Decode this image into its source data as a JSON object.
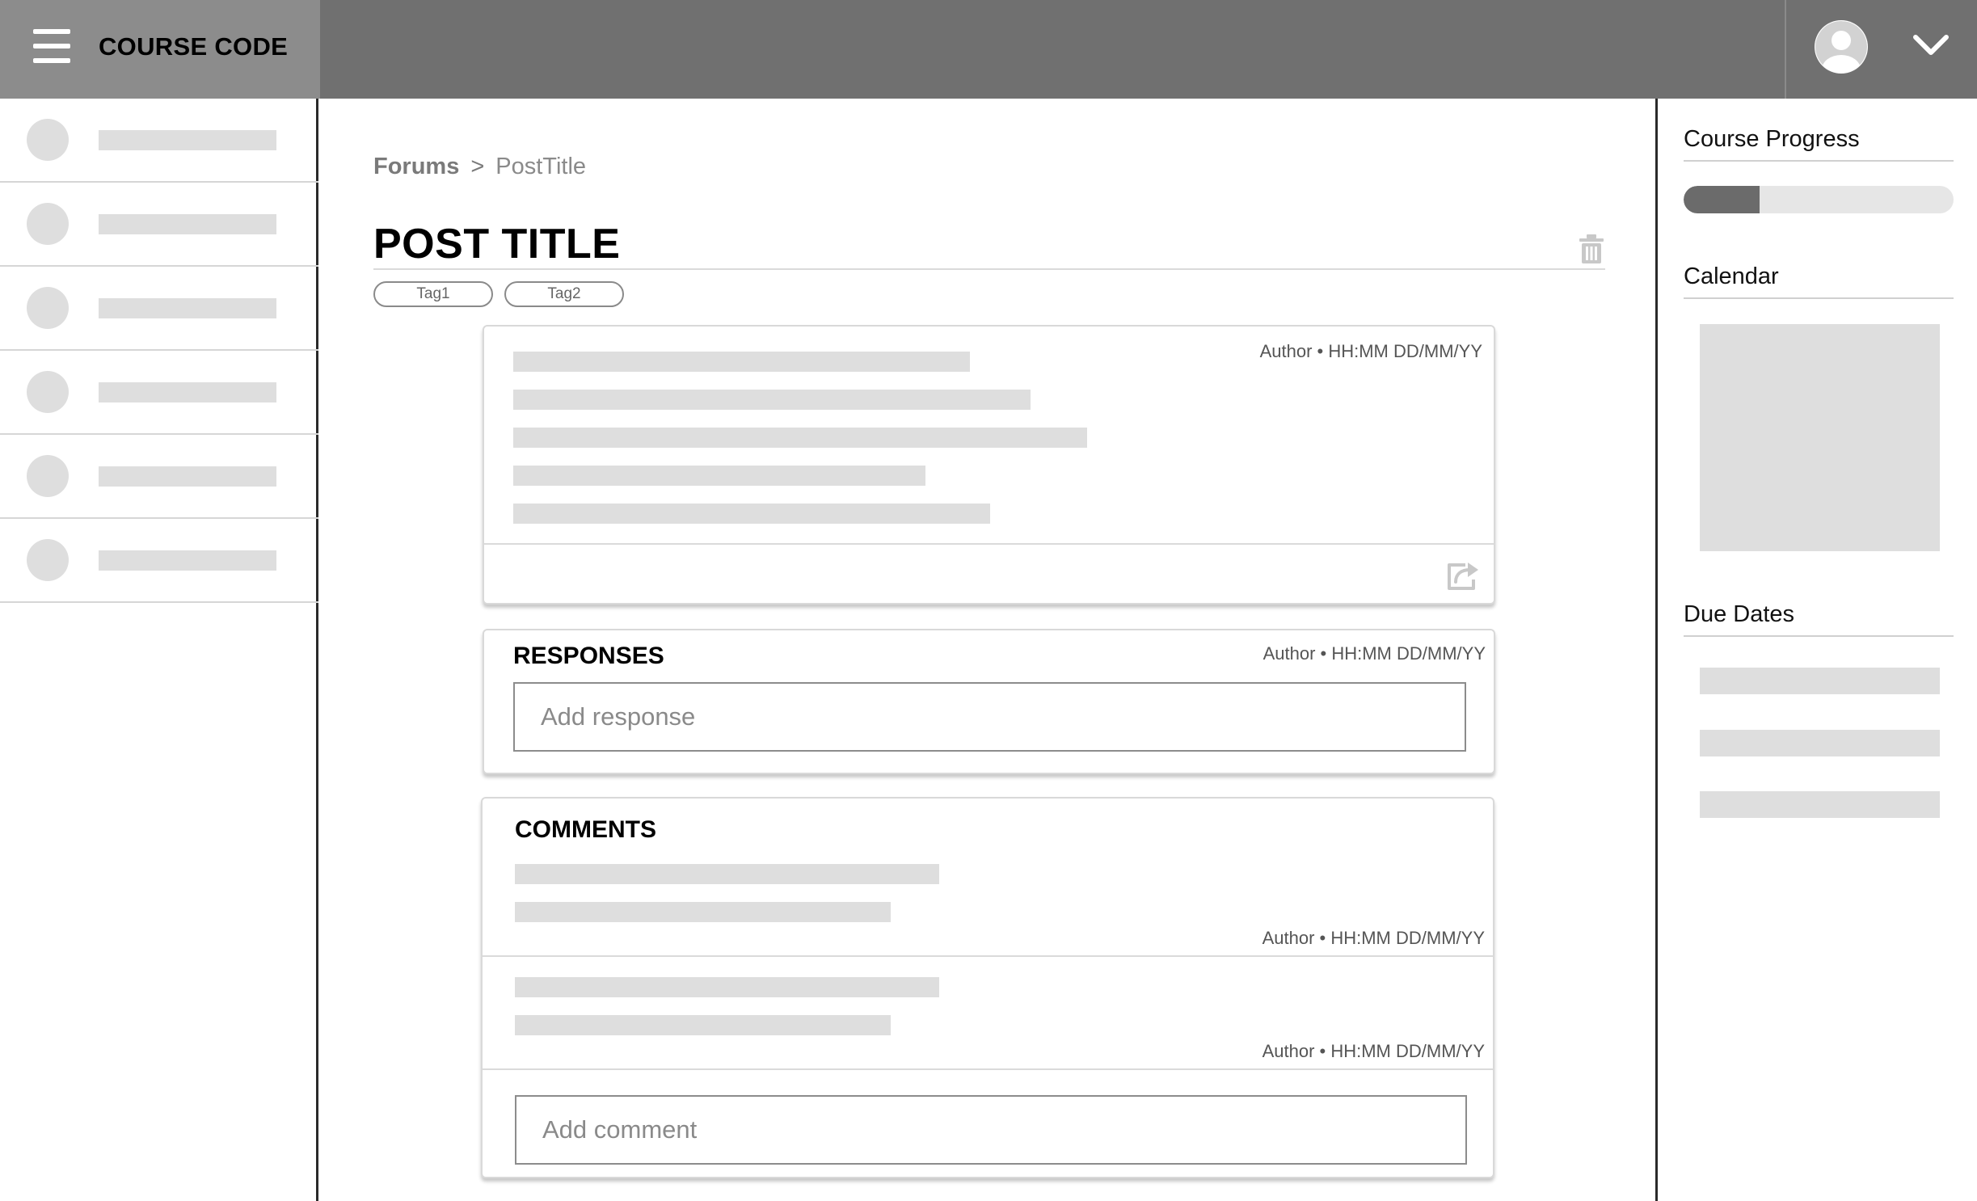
{
  "header": {
    "course_code": "COURSE CODE"
  },
  "breadcrumb": {
    "parent": "Forums",
    "separator": ">",
    "current": "PostTitle"
  },
  "post": {
    "title": "POST TITLE",
    "tags": [
      "Tag1",
      "Tag2"
    ],
    "meta": "Author • HH:MM DD/MM/YY"
  },
  "responses": {
    "heading": "RESPONSES",
    "meta": "Author • HH:MM DD/MM/YY",
    "input_placeholder": "Add response"
  },
  "comments": {
    "heading": "COMMENTS",
    "items": [
      {
        "meta": "Author • HH:MM DD/MM/YY"
      },
      {
        "meta": "Author • HH:MM DD/MM/YY"
      }
    ],
    "input_placeholder": "Add comment"
  },
  "right_panel": {
    "progress_heading": "Course Progress",
    "progress_fraction": 0.28,
    "calendar_heading": "Calendar",
    "due_dates_heading": "Due Dates"
  },
  "icons": {
    "menu": "hamburger-menu-icon",
    "avatar": "user-avatar-icon",
    "dropdown": "chevron-down-icon",
    "delete": "trash-icon",
    "share": "share-icon"
  },
  "colors": {
    "topbar": "#707070",
    "brand_panel": "#8c8c8c",
    "placeholder": "#dedede",
    "progress_fill": "#6b6b6b"
  }
}
